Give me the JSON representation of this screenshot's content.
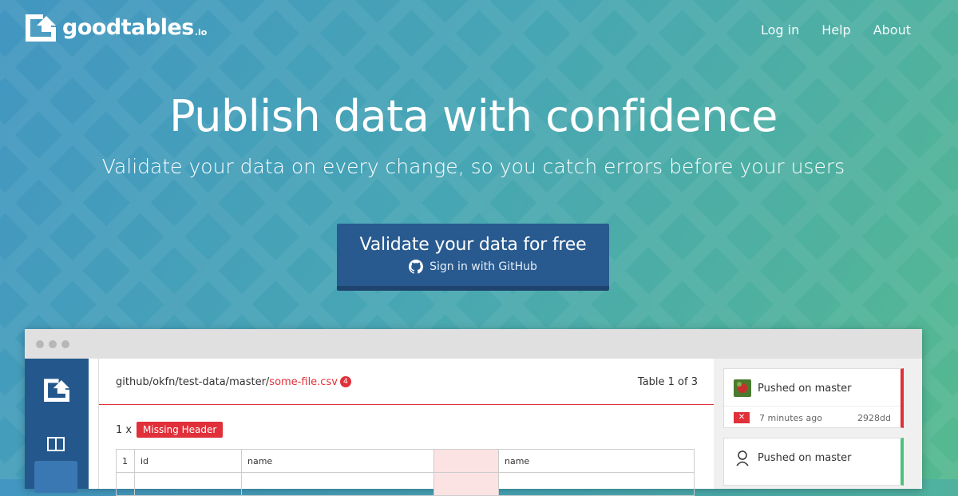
{
  "brand": {
    "name": "goodtables",
    "tld": ".io"
  },
  "nav": {
    "login": "Log in",
    "help": "Help",
    "about": "About"
  },
  "hero": {
    "title": "Publish data with confidence",
    "subtitle": "Validate your data on every change, so you catch errors before your users"
  },
  "cta": {
    "main": "Validate your data for free",
    "sub": "Sign in with GitHub"
  },
  "mock": {
    "breadcrumb_path": "github/okfn/test-data/master/",
    "breadcrumb_file": "some-file.csv",
    "error_badge": "4",
    "table_label": "Table 1 of 3",
    "error_count": "1 x",
    "error_tag": "Missing Header",
    "grid_row": [
      "1",
      "id",
      "name",
      "",
      "name"
    ],
    "cards": [
      {
        "title": "Pushed on master",
        "time": "7 minutes ago",
        "sha": "2928dd",
        "status": "fail"
      },
      {
        "title": "Pushed on master",
        "status": "ok"
      }
    ]
  },
  "colors": {
    "accent_red": "#e0303a",
    "cta_blue": "#285a8f",
    "sidebar_blue": "#24588c",
    "ok_green": "#4cc27a"
  }
}
